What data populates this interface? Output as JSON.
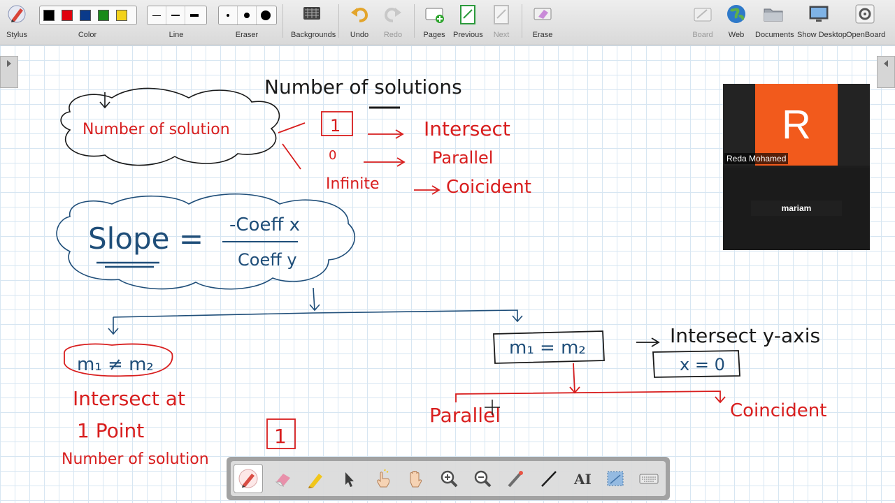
{
  "toolbar": {
    "stylus": "Stylus",
    "color": "Color",
    "line": "Line",
    "eraser": "Eraser",
    "backgrounds": "Backgrounds",
    "undo": "Undo",
    "redo": "Redo",
    "pages": "Pages",
    "previous": "Previous",
    "next": "Next",
    "erase": "Erase",
    "board": "Board",
    "web": "Web",
    "documents": "Documents",
    "show_desktop": "Show Desktop",
    "openboard": "OpenBoard",
    "colors": [
      "#000000",
      "#e0000d",
      "#0a3a8a",
      "#1a8a1a",
      "#f3d21a"
    ]
  },
  "whiteboard": {
    "title_note": "Number of solutions",
    "cloud1_text": "Number of solution",
    "one": "1",
    "zero": "0",
    "infinite": "Infinite",
    "intersect": "Intersect",
    "parallel": "Parallel",
    "coincident": "Coicident",
    "slope_label": "Slope =",
    "slope_numerator": "-Coeff x",
    "slope_denominator": "Coeff y",
    "m_not_equal": "m₁ ≠ m₂",
    "intersect_at": "Intersect at",
    "one_point": "1 Point",
    "num_solution_bottom": "Number of solution",
    "boxed_one": "1",
    "m_equal": "m₁ = m₂",
    "intersect_y_axis": "Intersect y-axis",
    "x_equals_0": "x = 0",
    "parallel_bottom": "Parallel",
    "coincident_bottom": "Coincident"
  },
  "video": {
    "participant1_initial": "R",
    "participant1_name": "Reda Mohamed",
    "participant2_name": "mariam",
    "avatar_color": "#f25a1c"
  },
  "palette": {
    "tools": [
      "pen",
      "eraser",
      "highlighter",
      "selector",
      "interact",
      "hand",
      "zoom-in",
      "zoom-out",
      "laser-pointer",
      "line",
      "text",
      "capture",
      "keyboard"
    ]
  },
  "colors": {
    "ink_red": "#d81e1e",
    "ink_blue": "#1f4e79",
    "ink_black": "#1a1a1a"
  }
}
